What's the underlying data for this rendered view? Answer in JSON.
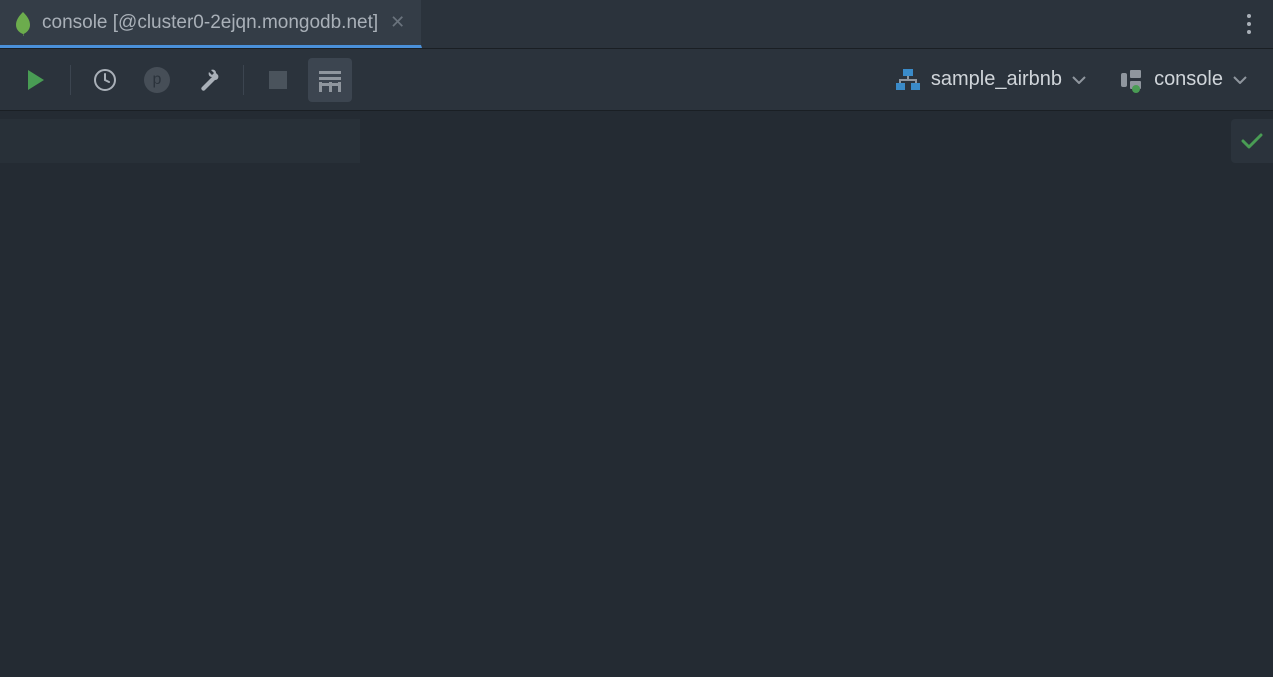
{
  "tab": {
    "title": "console [@cluster0-2ejqn.mongodb.net]"
  },
  "toolbar": {
    "p_badge": "p"
  },
  "selectors": {
    "database": {
      "label": "sample_airbnb"
    },
    "session": {
      "label": "console"
    }
  },
  "colors": {
    "play_green": "#499c54",
    "check_green": "#499c54",
    "tab_accent": "#4a90d9",
    "mongo_green": "#6cac4d"
  }
}
